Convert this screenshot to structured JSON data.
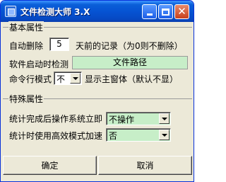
{
  "window": {
    "title": "文件检测大师 3.X",
    "close_glyph": "✕"
  },
  "basic": {
    "group_label": "基本属性",
    "autodelete_label": "自动删除",
    "autodelete_value": "5",
    "autodelete_suffix": "天前的记录（为0则不删除）",
    "startup_label": "软件启动时检测",
    "file_path": "文件路径",
    "cmd_label": "命令行模式",
    "cmd_value": "不",
    "cmd_suffix": "显示主窗体（默认不显）"
  },
  "special": {
    "group_label": "特殊属性",
    "after_label": "统计完成后操作系统立即",
    "after_value": "不操作",
    "efficient_label": "统计时使用高效模式加速",
    "efficient_value": "否"
  },
  "buttons": {
    "ok": "确定",
    "cancel": "取消"
  },
  "colors": {
    "titlebar": "#0653d3",
    "field_green": "#c7eec8",
    "face": "#ece9d8"
  },
  "icons": {
    "app": "app-icon",
    "minimize": "minimize-icon",
    "maximize": "maximize-icon",
    "close": "close-icon",
    "dropdown": "chevron-down-icon"
  }
}
